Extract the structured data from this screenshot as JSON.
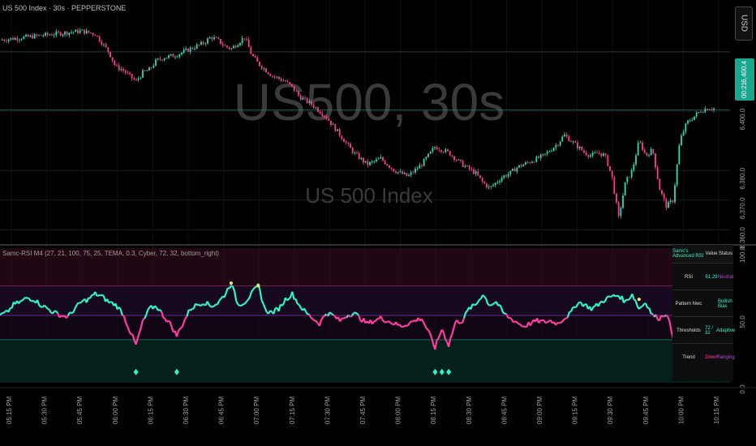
{
  "header": {
    "symbol_line": "US 500 Index · 30s · PEPPERSTONE",
    "watermark_symbol": "US500, 30s",
    "watermark_name": "US 500 Index",
    "currency_button": "USD",
    "last_price_top": "6,400.4",
    "last_price_bottom": "00:21"
  },
  "indicator": {
    "legend": "Samc-RSI M4 (27, 21, 100, 75, 25, TEMA, 0.3, Cyber, 72, 32, bottom_right)",
    "table": {
      "header": [
        "Samc's Advanced RSI",
        "Value",
        "Status"
      ],
      "rows": [
        {
          "label": "RSI",
          "value": "61.29",
          "status": "Neutral"
        },
        {
          "label": "Pattern Nwc",
          "value": "",
          "status": "Bullish Bias"
        },
        {
          "label": "Thresholds",
          "value": "72 / 32",
          "status": "Adaptive"
        },
        {
          "label": "Trend",
          "value": "Down",
          "status": "Ranging"
        }
      ]
    }
  },
  "colors": {
    "background": "#000000",
    "bull": "#26e0b0",
    "bear": "#ff3d8e",
    "rsi_bull": "#2df5c8",
    "rsi_bear": "#ff3da0",
    "overbought_band": "#3a0d22",
    "oversold_band": "#05231d",
    "mid_band": "#1a0a22",
    "grid": "#1e1e1e",
    "price_line": "#26a69a",
    "accent_purple": "#9c27b0"
  },
  "chart_data": [
    {
      "type": "candlestick",
      "title": "US 500 Index · 30s · PEPPERSTONE",
      "y_ticks": [
        6420.0,
        6400.0,
        6380.0,
        6370.0,
        6360.0
      ],
      "y_tick_labels": [
        "6,400.0",
        "6,380.0",
        "6,370.0",
        "6,360.0"
      ],
      "ylim": [
        6356,
        6432
      ],
      "x_tick_labels": [
        "05:15 PM",
        "05:30 PM",
        "05:45 PM",
        "06:00 PM",
        "06:15 PM",
        "06:30 PM",
        "06:45 PM",
        "07:00 PM",
        "07:15 PM",
        "07:30 PM",
        "07:45 PM",
        "08:00 PM",
        "08:15 PM",
        "08:30 PM",
        "08:45 PM",
        "09:00 PM",
        "09:15 PM",
        "09:30 PM",
        "09:45 PM",
        "10:00 PM",
        "10:15 PM"
      ],
      "close_path": [
        [
          0,
          6424
        ],
        [
          4,
          6425
        ],
        [
          8,
          6426
        ],
        [
          12,
          6427
        ],
        [
          14,
          6426
        ],
        [
          16,
          6420
        ],
        [
          17,
          6415
        ],
        [
          18,
          6414
        ],
        [
          19,
          6412
        ],
        [
          20,
          6410
        ],
        [
          21,
          6413
        ],
        [
          22,
          6414
        ],
        [
          23,
          6417
        ],
        [
          24,
          6418
        ],
        [
          26,
          6419
        ],
        [
          28,
          6421
        ],
        [
          29,
          6422
        ],
        [
          30,
          6423
        ],
        [
          31,
          6425
        ],
        [
          32,
          6424
        ],
        [
          33,
          6422
        ],
        [
          34,
          6421
        ],
        [
          35,
          6423
        ],
        [
          36,
          6425
        ],
        [
          37,
          6419
        ],
        [
          38,
          6416
        ],
        [
          39,
          6414
        ],
        [
          40,
          6412
        ],
        [
          41,
          6411
        ],
        [
          42,
          6410
        ],
        [
          43,
          6408
        ],
        [
          44,
          6405
        ],
        [
          46,
          6402
        ],
        [
          48,
          6398
        ],
        [
          50,
          6392
        ],
        [
          52,
          6386
        ],
        [
          54,
          6382
        ],
        [
          56,
          6384
        ],
        [
          58,
          6380
        ],
        [
          60,
          6378
        ],
        [
          62,
          6382
        ],
        [
          64,
          6388
        ],
        [
          66,
          6386
        ],
        [
          68,
          6382
        ],
        [
          70,
          6379
        ],
        [
          71,
          6376
        ],
        [
          72,
          6374
        ],
        [
          73,
          6376
        ],
        [
          74,
          6378
        ],
        [
          75,
          6379
        ],
        [
          76,
          6381
        ],
        [
          77,
          6382
        ],
        [
          78,
          6383
        ],
        [
          79,
          6384
        ],
        [
          80,
          6385
        ],
        [
          82,
          6389
        ],
        [
          83,
          6392
        ],
        [
          84,
          6390
        ],
        [
          85,
          6388
        ],
        [
          86,
          6386
        ],
        [
          87,
          6385
        ],
        [
          88,
          6386
        ],
        [
          89,
          6385
        ],
        [
          90,
          6378
        ],
        [
          91,
          6364
        ],
        [
          92,
          6376
        ],
        [
          93,
          6380
        ],
        [
          94,
          6390
        ],
        [
          95,
          6385
        ],
        [
          96,
          6387
        ],
        [
          97,
          6374
        ],
        [
          98,
          6368
        ],
        [
          99,
          6370
        ],
        [
          100,
          6390
        ],
        [
          101,
          6396
        ],
        [
          102,
          6398
        ],
        [
          103,
          6400
        ],
        [
          104,
          6401
        ],
        [
          105,
          6401
        ]
      ]
    },
    {
      "type": "line",
      "title": "Samc-RSI M4",
      "ylim": [
        0,
        100
      ],
      "y_ticks": [
        0,
        50,
        100
      ],
      "overbought": 72,
      "oversold": 32,
      "midline": 50,
      "rsi": [
        [
          0,
          50
        ],
        [
          1,
          52
        ],
        [
          2,
          58
        ],
        [
          3,
          60
        ],
        [
          4,
          63
        ],
        [
          5,
          62
        ],
        [
          6,
          58
        ],
        [
          7,
          55
        ],
        [
          8,
          52
        ],
        [
          9,
          50
        ],
        [
          10,
          49
        ],
        [
          11,
          55
        ],
        [
          12,
          60
        ],
        [
          13,
          62
        ],
        [
          14,
          66
        ],
        [
          15,
          64
        ],
        [
          16,
          60
        ],
        [
          17,
          58
        ],
        [
          18,
          52
        ],
        [
          19,
          40
        ],
        [
          20,
          28
        ],
        [
          21,
          45
        ],
        [
          22,
          55
        ],
        [
          23,
          57
        ],
        [
          24,
          50
        ],
        [
          25,
          44
        ],
        [
          26,
          35
        ],
        [
          27,
          45
        ],
        [
          28,
          55
        ],
        [
          29,
          58
        ],
        [
          30,
          60
        ],
        [
          31,
          57
        ],
        [
          32,
          59
        ],
        [
          33,
          65
        ],
        [
          34,
          74
        ],
        [
          35,
          58
        ],
        [
          36,
          60
        ],
        [
          37,
          66
        ],
        [
          38,
          72
        ],
        [
          39,
          54
        ],
        [
          40,
          52
        ],
        [
          41,
          55
        ],
        [
          42,
          62
        ],
        [
          43,
          66
        ],
        [
          44,
          58
        ],
        [
          45,
          52
        ],
        [
          46,
          48
        ],
        [
          47,
          44
        ],
        [
          48,
          52
        ],
        [
          49,
          50
        ],
        [
          50,
          46
        ],
        [
          51,
          50
        ],
        [
          52,
          52
        ],
        [
          53,
          48
        ],
        [
          54,
          44
        ],
        [
          55,
          46
        ],
        [
          56,
          48
        ],
        [
          57,
          46
        ],
        [
          58,
          44
        ],
        [
          59,
          42
        ],
        [
          60,
          44
        ],
        [
          61,
          46
        ],
        [
          62,
          48
        ],
        [
          63,
          38
        ],
        [
          64,
          26
        ],
        [
          65,
          40
        ],
        [
          66,
          28
        ],
        [
          67,
          45
        ],
        [
          68,
          46
        ],
        [
          69,
          55
        ],
        [
          70,
          58
        ],
        [
          71,
          66
        ],
        [
          72,
          58
        ],
        [
          73,
          60
        ],
        [
          74,
          52
        ],
        [
          75,
          48
        ],
        [
          76,
          45
        ],
        [
          77,
          42
        ],
        [
          78,
          44
        ],
        [
          79,
          46
        ],
        [
          80,
          45
        ],
        [
          81,
          46
        ],
        [
          82,
          44
        ],
        [
          83,
          48
        ],
        [
          84,
          52
        ],
        [
          85,
          60
        ],
        [
          86,
          58
        ],
        [
          87,
          55
        ],
        [
          88,
          58
        ],
        [
          89,
          62
        ],
        [
          90,
          64
        ],
        [
          91,
          65
        ],
        [
          92,
          60
        ],
        [
          93,
          66
        ],
        [
          94,
          55
        ],
        [
          95,
          60
        ],
        [
          96,
          50
        ],
        [
          97,
          48
        ],
        [
          98,
          52
        ],
        [
          99,
          35
        ],
        [
          100,
          28
        ],
        [
          101,
          40
        ],
        [
          102,
          50
        ],
        [
          103,
          55
        ],
        [
          104,
          58
        ],
        [
          105,
          59
        ]
      ]
    }
  ]
}
